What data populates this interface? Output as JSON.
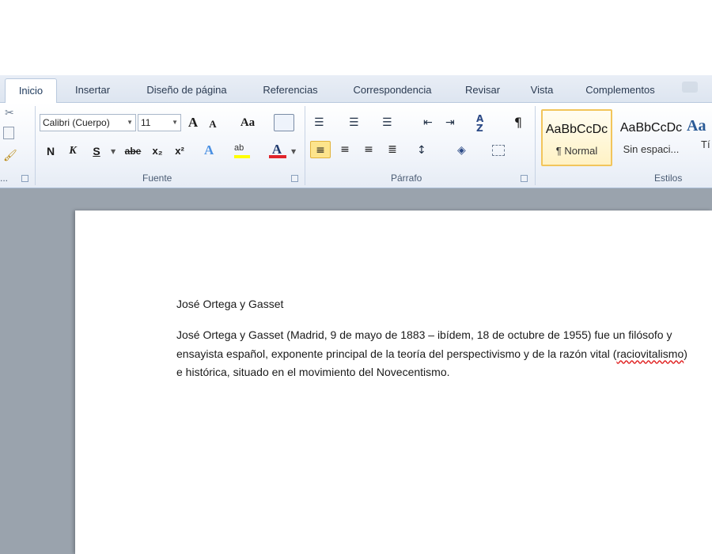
{
  "tabs": [
    {
      "label": "Inicio"
    },
    {
      "label": "Insertar"
    },
    {
      "label": "Diseño de página"
    },
    {
      "label": "Referencias"
    },
    {
      "label": "Correspondencia"
    },
    {
      "label": "Revisar"
    },
    {
      "label": "Vista"
    },
    {
      "label": "Complementos"
    }
  ],
  "ribbon": {
    "clipboard": {
      "label": "..."
    },
    "font": {
      "label": "Fuente",
      "font_name": "Calibri (Cuerpo)",
      "font_size": "11",
      "bold": "N",
      "italic": "K",
      "underline": "S",
      "strikethrough": "abe",
      "subscript": "x₂",
      "superscript": "x²",
      "grow": "A",
      "shrink": "A",
      "change_case": "Aa",
      "font_color": "A"
    },
    "paragraph": {
      "label": "Párrafo",
      "pilcrow": "¶"
    },
    "styles": {
      "label": "Estilos",
      "items": [
        {
          "sample": "AaBbCcDc",
          "name": "¶ Normal"
        },
        {
          "sample": "AaBbCcDc",
          "name": "Sin espaci..."
        },
        {
          "sample": "Aa",
          "name": "Tí"
        }
      ]
    }
  },
  "document": {
    "title": "José Ortega y Gasset",
    "para_before": "José Ortega y Gasset (Madrid, 9 de mayo de 1883 – ibídem, 18 de octubre de 1955) fue un filósofo y ensayista español, exponente principal de la teoría del perspectivismo y de la razón vital (",
    "para_misspelled": "raciovitalismo",
    "para_after": ") e histórica, situado en el movimiento del Novecentismo."
  },
  "colors": {
    "accent_highlight": "#fde48c",
    "font_color_bar": "#e0242b",
    "highlight_bar": "#ffff00"
  }
}
